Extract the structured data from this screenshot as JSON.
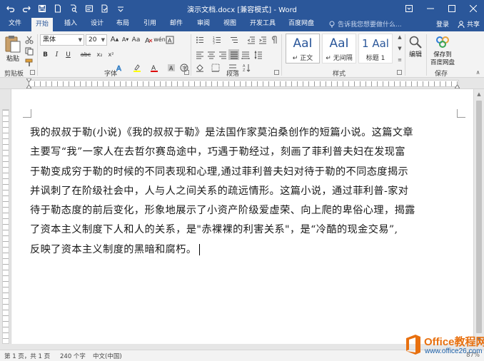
{
  "app": {
    "title": "演示文档.docx [兼容模式] - Word",
    "brand_color": "#2b579a"
  },
  "qat": {
    "icons": [
      "undo-icon",
      "redo-icon",
      "save-icon",
      "document-icon",
      "print-preview-icon",
      "format-icon",
      "spell-check-icon",
      "customize-icon"
    ]
  },
  "tabs": [
    {
      "label": "文件"
    },
    {
      "label": "开始"
    },
    {
      "label": "插入"
    },
    {
      "label": "设计"
    },
    {
      "label": "布局"
    },
    {
      "label": "引用"
    },
    {
      "label": "邮件"
    },
    {
      "label": "审阅"
    },
    {
      "label": "视图"
    },
    {
      "label": "开发工具"
    },
    {
      "label": "百度网盘"
    }
  ],
  "active_tab": "开始",
  "tell_me": {
    "placeholder": "告诉我您想要做什么..."
  },
  "account": {
    "signin": "登录",
    "share": "共享"
  },
  "ribbon": {
    "clipboard": {
      "paste": "粘贴",
      "label": "剪贴板"
    },
    "font": {
      "name": "黑体",
      "size": "20",
      "label": "字体",
      "buttons": [
        "B",
        "I",
        "U",
        "abc",
        "x₂",
        "x²",
        "A",
        "A",
        "A",
        "Aa"
      ],
      "wen": "wén"
    },
    "paragraph": {
      "label": "段落"
    },
    "styles": {
      "label": "样式",
      "items": [
        {
          "sample": "AaI",
          "name": "↵ 正文"
        },
        {
          "sample": "AaI",
          "name": "↵ 无间隔"
        },
        {
          "sample": "1 Aal",
          "name": "标题 1"
        }
      ]
    },
    "editing": {
      "label": "编辑"
    },
    "baidu": {
      "label": "保存到\n百度网盘",
      "group": "保存"
    }
  },
  "document": {
    "lines": [
      "我的叔叔于勒(小说)《我的叔叔于勒》是法国作家莫泊桑创作的短篇小说。这篇文章",
      "主要写“我”一家人在去哲尔赛岛途中，巧遇于勒经过，刻画了菲利普夫妇在发现富",
      "于勒变成穷于勒的时候的不同表现和心理,通过菲利普夫妇对待于勒的不同态度揭示",
      "并讽刺了在阶级社会中，人与人之间关系的疏远情形。这篇小说，通过菲利普-家对",
      "待于勒态度的前后变化，形象地展示了小资产阶级爱虚荣、向上爬的卑俗心理，揭露",
      "了资本主义制度下人和人的关系，是\"赤裸裸的利害关系\"，是“冷酷的现金交易”,",
      "反映了资本主义制度的黑暗和腐朽。"
    ]
  },
  "status": {
    "page": "第 1 页，共 1 页",
    "words": "240 个字",
    "language": "中文(中国)",
    "zoom": "87%"
  },
  "watermark": {
    "title": "Office教程网",
    "url": "www.office26.com",
    "colors": {
      "orange": "#e8700f",
      "blue": "#1b5fa8"
    }
  }
}
